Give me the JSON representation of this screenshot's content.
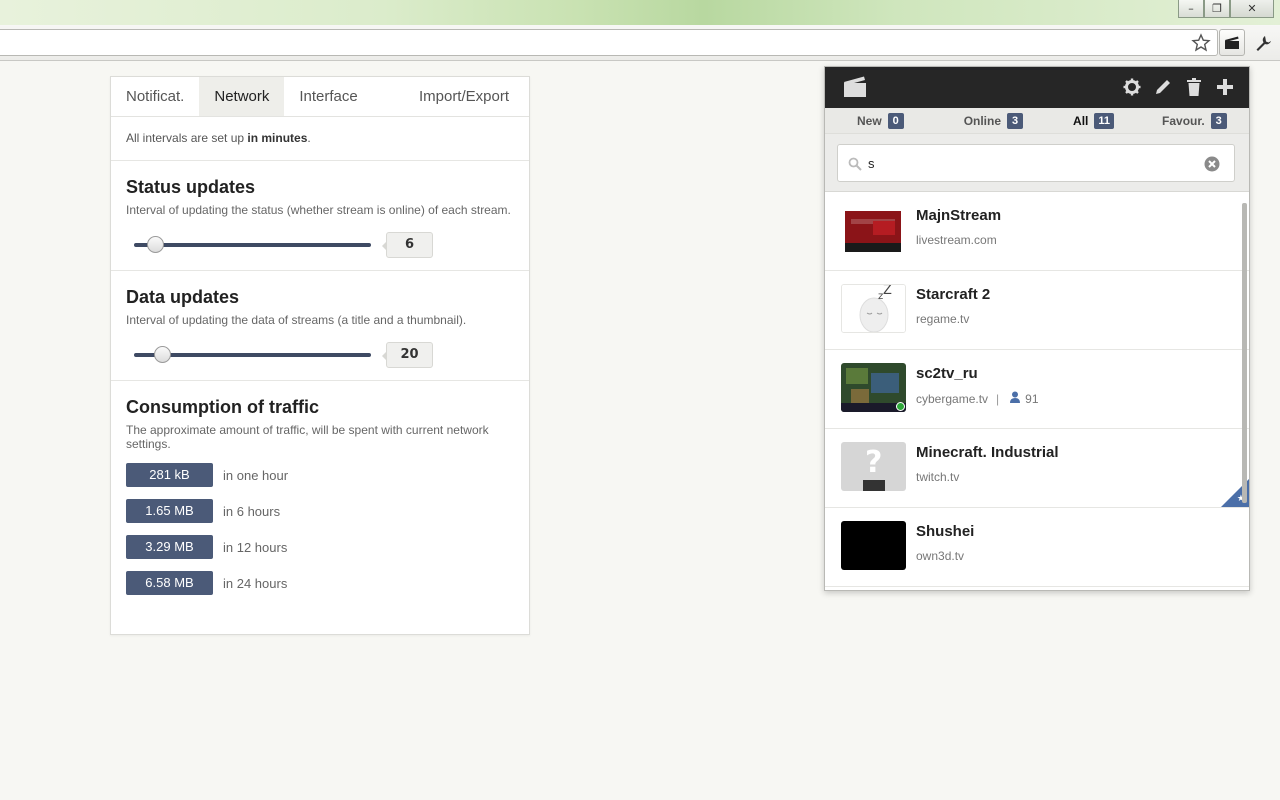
{
  "browser": {
    "window_controls": [
      "–",
      "❐",
      "✕"
    ]
  },
  "options": {
    "tabs": [
      {
        "label": "Notificat.",
        "active": false
      },
      {
        "label": "Network",
        "active": true
      },
      {
        "label": "Interface",
        "active": false
      },
      {
        "label": "Import/Export",
        "active": false
      }
    ],
    "intro_prefix": "All intervals are set up ",
    "intro_bold": "in minutes",
    "intro_suffix": ".",
    "status": {
      "title": "Status updates",
      "desc": "Interval of updating the status (whether stream is online) of each stream.",
      "value": "6",
      "level": 0.06
    },
    "data": {
      "title": "Data updates",
      "desc": "Interval of updating the data of streams (a title and a thumbnail).",
      "value": "20",
      "level": 0.09
    },
    "traffic": {
      "title": "Consumption of traffic",
      "desc": "The approximate amount of traffic, will be spent with current network settings.",
      "rows": [
        {
          "amount": "281 kB",
          "period": "in one hour"
        },
        {
          "amount": "1.65 MB",
          "period": "in 6 hours"
        },
        {
          "amount": "3.29 MB",
          "period": "in 12 hours"
        },
        {
          "amount": "6.58 MB",
          "period": "in 24 hours"
        }
      ]
    }
  },
  "popup": {
    "filters": [
      {
        "label": "New",
        "count": "0",
        "active": false
      },
      {
        "label": "Online",
        "count": "3",
        "active": false
      },
      {
        "label": "All",
        "count": "11",
        "active": true
      },
      {
        "label": "Favour.",
        "count": "3",
        "active": false
      }
    ],
    "search_value": "s",
    "streams": [
      {
        "title": "MajnStream",
        "host": "livestream.com",
        "viewers": "",
        "favourite": false
      },
      {
        "title": "Starcraft 2",
        "host": "regame.tv",
        "viewers": "",
        "favourite": false
      },
      {
        "title": "sc2tv_ru",
        "host": "cybergame.tv",
        "viewers": "91",
        "favourite": false
      },
      {
        "title": "Minecraft. Industrial",
        "host": "twitch.tv",
        "viewers": "",
        "favourite": true
      },
      {
        "title": "Shushei",
        "host": "own3d.tv",
        "viewers": "",
        "favourite": false
      }
    ],
    "colors": {
      "accent": "#4b5a78",
      "header": "#262626",
      "favourite": "#4b6fa8"
    }
  }
}
